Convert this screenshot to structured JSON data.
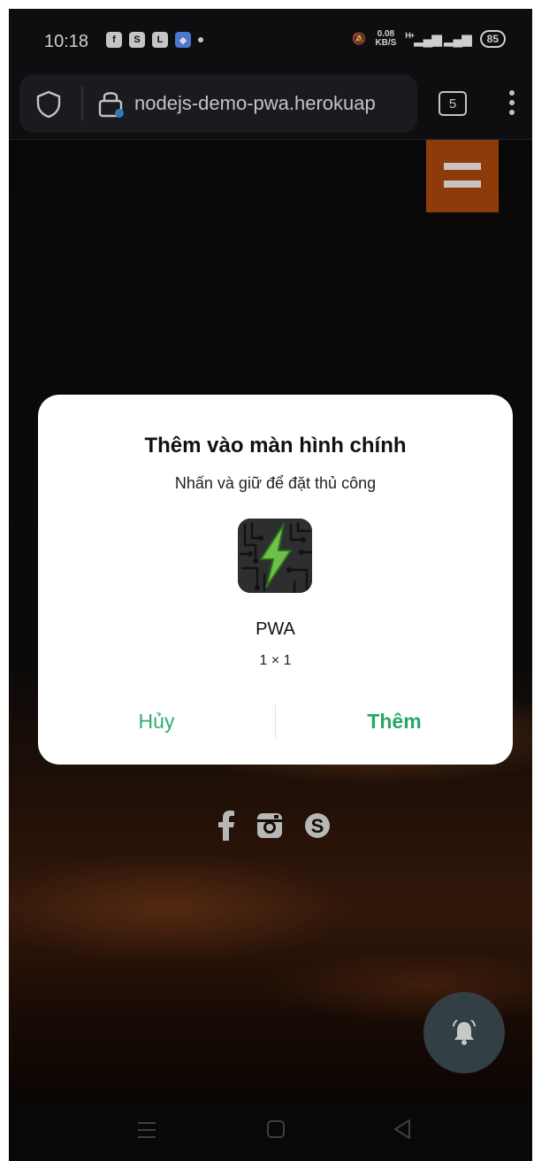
{
  "status_bar": {
    "time": "10:18",
    "speed_value": "0.08",
    "speed_unit": "KB/S",
    "network": "H+",
    "battery": "85"
  },
  "browser": {
    "url": "nodejs-demo-pwa.herokuap",
    "tab_count": "5"
  },
  "dialog": {
    "title": "Thêm vào màn hình chính",
    "subtitle": "Nhấn và giữ để đặt thủ công",
    "app_name": "PWA",
    "app_size": "1 × 1",
    "cancel_label": "Hủy",
    "add_label": "Thêm"
  },
  "colors": {
    "accent_green": "#27a66a",
    "menu_button": "#a6460c",
    "fab": "#3b4a52"
  },
  "icons": [
    "shield-icon",
    "lock-icon",
    "menu-icon",
    "facebook-icon",
    "instagram-icon",
    "skype-icon",
    "bell-icon",
    "lightning-icon"
  ]
}
